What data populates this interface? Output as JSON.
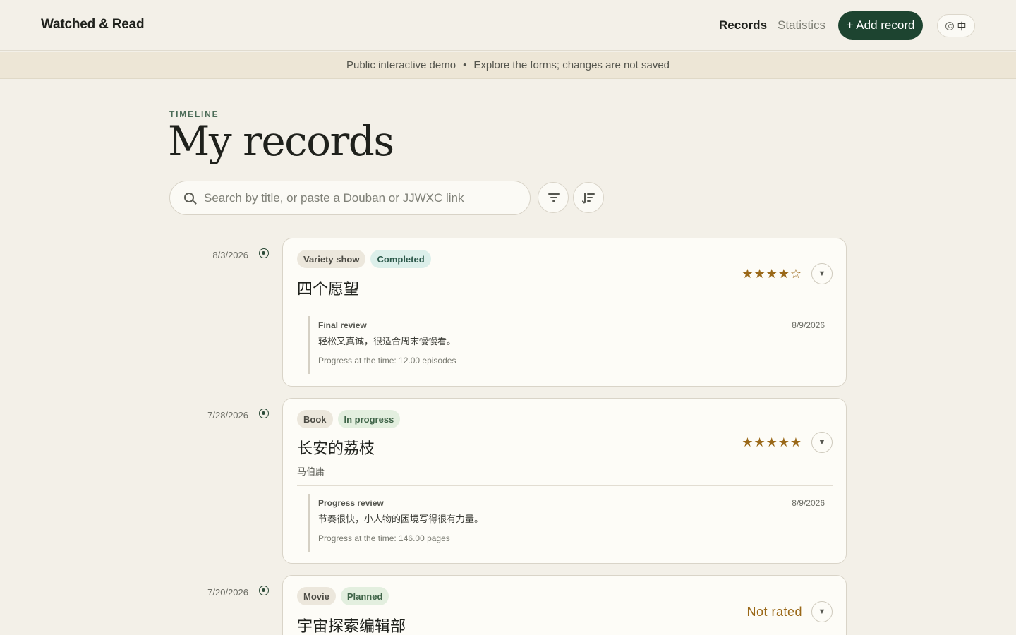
{
  "header": {
    "brand": "Watched & Read",
    "nav": {
      "records": "Records",
      "statistics": "Statistics"
    },
    "add_button": "+ Add record",
    "lang_label": "中"
  },
  "banner": {
    "left": "Public interactive demo",
    "separator": "•",
    "right": "Explore the forms; changes are not saved"
  },
  "page": {
    "eyebrow": "TIMELINE",
    "title": "My records"
  },
  "search": {
    "placeholder": "Search by title, or paste a Douban or JJWXC link",
    "value": ""
  },
  "records": [
    {
      "date": "8/3/2026",
      "type": "Variety show",
      "status": "Completed",
      "title": "四个愿望",
      "author": "",
      "rating_stars": "★★★★☆",
      "rating": 4,
      "review": {
        "kind": "Final review",
        "date": "8/9/2026",
        "text": "轻松又真诚，很适合周末慢慢看。",
        "progress": "Progress at the time: 12.00 episodes"
      }
    },
    {
      "date": "7/28/2026",
      "type": "Book",
      "status": "In progress",
      "title": "长安的荔枝",
      "author": "马伯庸",
      "rating_stars": "★★★★★",
      "rating": 5,
      "review": {
        "kind": "Progress review",
        "date": "8/9/2026",
        "text": "节奏很快，小人物的困境写得很有力量。",
        "progress": "Progress at the time: 146.00 pages"
      }
    },
    {
      "date": "7/20/2026",
      "type": "Movie",
      "status": "Planned",
      "title": "宇宙探索编辑部",
      "rating_text": "Not rated"
    }
  ],
  "expand_glyph": "▼",
  "colors": {
    "background": "#f3f0e8",
    "primary": "#1d4430",
    "star": "#9a6818",
    "banner": "#ede6d6"
  }
}
